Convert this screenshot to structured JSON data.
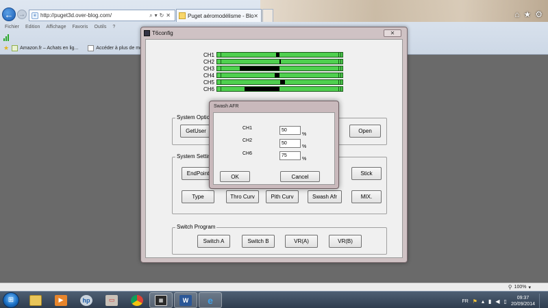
{
  "browser": {
    "url": "http://puget3d.over-blog.com/",
    "tab_title": "Puget aéromodélisme - Blo...",
    "tab_close": "✕",
    "menu": [
      "Fichier",
      "Edition",
      "Affichage",
      "Favoris",
      "Outils",
      "?"
    ],
    "favorites": [
      {
        "label": "Amazon.fr – Achats en lig..."
      },
      {
        "label": "Accéder à plus de mod..."
      }
    ],
    "zoom": "100%"
  },
  "window": {
    "title": "T6config",
    "close_label": "✕",
    "channels": [
      {
        "label": "CH1",
        "fill_from": 0.47,
        "fill_to": 0.5
      },
      {
        "label": "CH2",
        "fill_from": 0.495,
        "fill_to": 0.505
      },
      {
        "label": "CH3",
        "fill_from": 0.18,
        "fill_to": 0.5
      },
      {
        "label": "CH4",
        "fill_from": 0.46,
        "fill_to": 0.5
      },
      {
        "label": "CH5",
        "fill_from": 0.5,
        "fill_to": 0.54
      },
      {
        "label": "CH6",
        "fill_from": 0.22,
        "fill_to": 0.5
      }
    ],
    "system_options": {
      "label": "System Option",
      "getuser": "GetUser",
      "open": "Open"
    },
    "system_settings": {
      "label": "System Setting",
      "endpoint": "EndPoint",
      "stick": "Stick",
      "type": "Type",
      "thro_curv": "Thro Curv",
      "pith_curv": "Pith Curv",
      "swash_afr": "Swash Afr",
      "mix": "MIX."
    },
    "switch_program": {
      "label": "Switch Program",
      "switch_a": "Switch A",
      "switch_b": "Switch B",
      "vra": "VR(A)",
      "vrb": "VR(B)"
    }
  },
  "dialog": {
    "title": "Swash AFR",
    "rows": [
      {
        "label": "CH1",
        "value": "50",
        "unit": "%"
      },
      {
        "label": "CH2",
        "value": "50",
        "unit": "%"
      },
      {
        "label": "CH6",
        "value": "75",
        "unit": "%"
      }
    ],
    "ok": "OK",
    "cancel": "Cancel"
  },
  "taskbar": {
    "lang": "FR",
    "time": "09:37",
    "date": "20/09/2014"
  }
}
